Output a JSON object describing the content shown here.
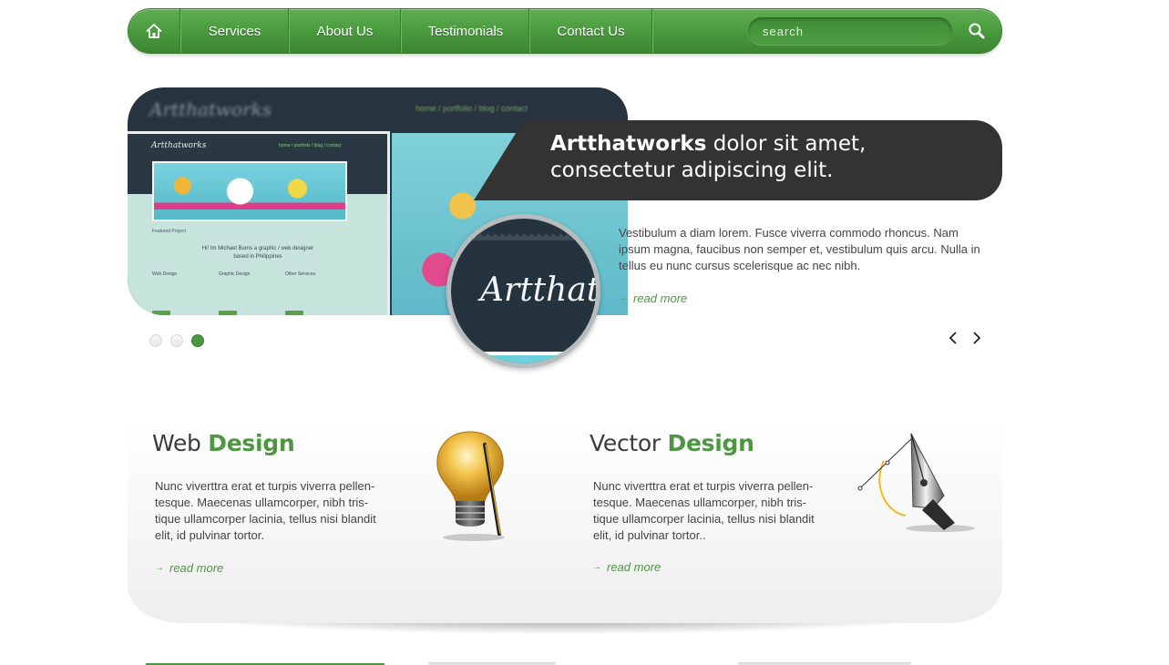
{
  "nav": {
    "home_icon": "home-icon",
    "items": [
      {
        "label": "Services"
      },
      {
        "label": "About Us"
      },
      {
        "label": "Testimonials"
      },
      {
        "label": "Contact Us"
      }
    ],
    "search": {
      "placeholder": "search",
      "value": "",
      "icon": "search-icon"
    }
  },
  "hero": {
    "caption_bold": "Artthatworks",
    "caption_rest": " dolor sit amet, consectetur adipiscing elit.",
    "body": "Vestibulum a diam lorem. Fusce viverra commodo rhoncus. Nam ipsum magna, faucibus non semper et, vestibulum quis arcu. Nulla in tellus eu nunc cursus scelerisque ac nec nibh.",
    "read_more": "read more",
    "read_more_arrow": "→",
    "magnifier_text": "Artthatworks",
    "slides": {
      "count": 3,
      "active": 3
    },
    "prev_icon": "chevron-left-icon",
    "next_icon": "chevron-right-icon",
    "screenshot": {
      "logo": "Artthatworks",
      "links": "home / portfolio / blog / contact",
      "featured": "Featured Project",
      "hello_line1": "Hi! Im Michael Burns a graphic / web designer",
      "hello_line2": "based in Philippines",
      "col_titles": [
        "Web Design",
        "Graphic Design",
        "Other Services"
      ]
    }
  },
  "features": [
    {
      "title_light": "Web ",
      "title_accent": "Design",
      "text": "Nunc viverttra erat et turpis viverra pellen-tesque. Maecenas ullamcorper, nibh tris-tique ullamcorper lacinia, tellus nisi blandit elit, id pulvinar tortor.",
      "read_more": "read more",
      "icon": "lightbulb-icon"
    },
    {
      "title_light": "Vector ",
      "title_accent": "Design",
      "text": "Nunc viverttra erat et turpis viverra pellen-tesque. Maecenas ullamcorper, nibh tris-tique ullamcorper lacinia, tellus nisi blandit elit, id pulvinar tortor..",
      "read_more": "read more",
      "icon": "pen-tool-icon"
    }
  ],
  "colors": {
    "accent": "#4e9642",
    "nav_green": "#4a9a3e",
    "caption_bg": "#333333"
  }
}
